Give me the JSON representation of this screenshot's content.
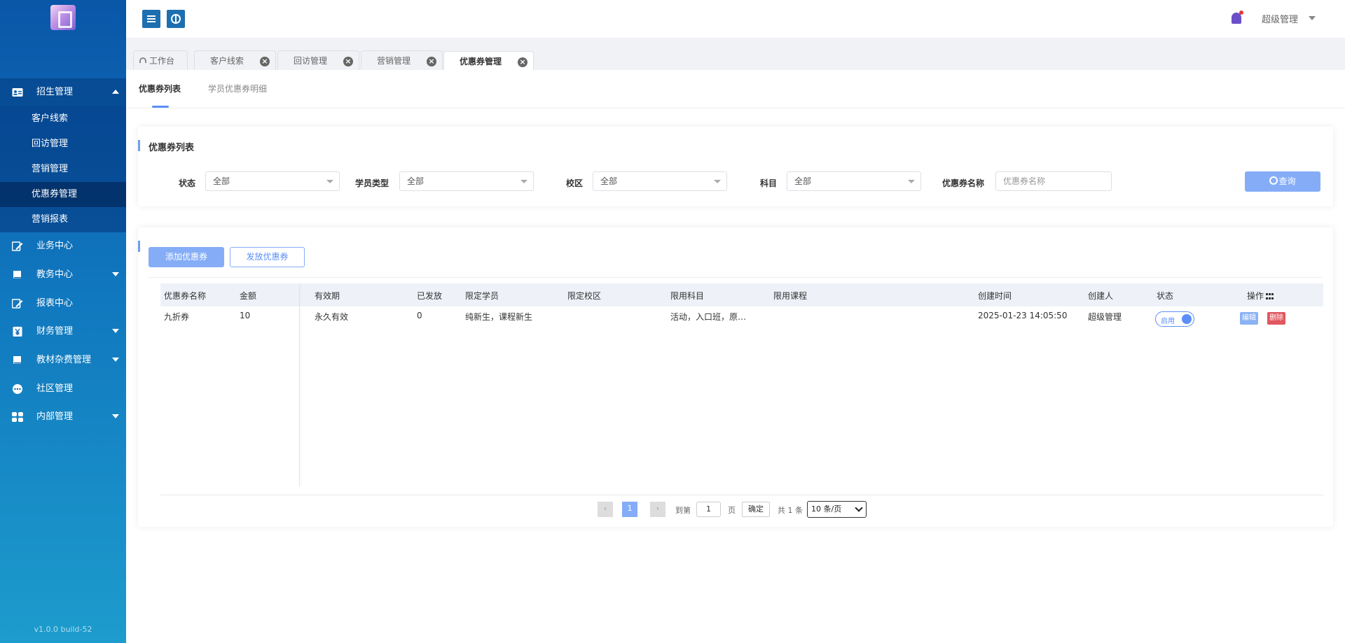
{
  "app": {
    "version": "v1.0.0 build-52",
    "user": "超级管理"
  },
  "sidebar": {
    "groups": [
      {
        "label": "招生管理",
        "icon": "id-card-icon",
        "expanded": true,
        "items": [
          {
            "label": "客户线索"
          },
          {
            "label": "回访管理"
          },
          {
            "label": "营销管理"
          },
          {
            "label": "优惠券管理",
            "active": true
          },
          {
            "label": "营销报表"
          }
        ]
      },
      {
        "label": "业务中心",
        "icon": "edit-icon"
      },
      {
        "label": "教务中心",
        "icon": "book-icon"
      },
      {
        "label": "报表中心",
        "icon": "report-icon"
      },
      {
        "label": "财务管理",
        "icon": "yen-icon"
      },
      {
        "label": "教材杂费管理",
        "icon": "book-icon"
      },
      {
        "label": "社区管理",
        "icon": "chat-icon"
      },
      {
        "label": "内部管理",
        "icon": "grid-icon"
      }
    ]
  },
  "page_tabs": [
    {
      "label": "工作台"
    },
    {
      "label": "客户线索"
    },
    {
      "label": "回访管理"
    },
    {
      "label": "营销管理"
    },
    {
      "label": "优惠券管理",
      "active": true
    }
  ],
  "sub_tabs": [
    {
      "label": "优惠券列表",
      "active": true
    },
    {
      "label": "学员优惠券明细"
    }
  ],
  "filter": {
    "title": "优惠券列表",
    "fields": [
      {
        "label": "状态",
        "value": "全部"
      },
      {
        "label": "学员类型",
        "value": "全部"
      },
      {
        "label": "校区",
        "value": "全部"
      },
      {
        "label": "科目",
        "value": "全部"
      }
    ],
    "name_label": "优惠券名称",
    "name_placeholder": "优惠券名称",
    "search_label": "查询"
  },
  "list": {
    "add_label": "添加优惠券",
    "issue_label": "发放优惠券",
    "columns": [
      "优惠券名称",
      "金额",
      "有效期",
      "已发放",
      "限定学员",
      "限定校区",
      "限用科目",
      "限用课程",
      "创建时间",
      "创建人",
      "状态",
      "操作"
    ],
    "rows": [
      {
        "name": "九折券",
        "amount": "10",
        "validity": "永久有效",
        "issued": "0",
        "students": "纯新生，课程新生",
        "campus": "",
        "subjects": "活动，入口班，原…",
        "courses": "",
        "created": "2025-01-23 14:05:50",
        "creator": "超级管理",
        "status": "启用",
        "edit": "编辑",
        "delete": "删除"
      }
    ]
  },
  "pager": {
    "current": "1",
    "goto_label": "到第",
    "page_input": "1",
    "page_unit": "页",
    "ok_label": "确定",
    "total": "共 1 条",
    "size": "10 条/页"
  },
  "colors": {
    "accent": "#85adf7",
    "sidebar_top": "#0a56a8",
    "sidebar_bottom": "#1d9ccd",
    "danger": "#e0575f"
  }
}
